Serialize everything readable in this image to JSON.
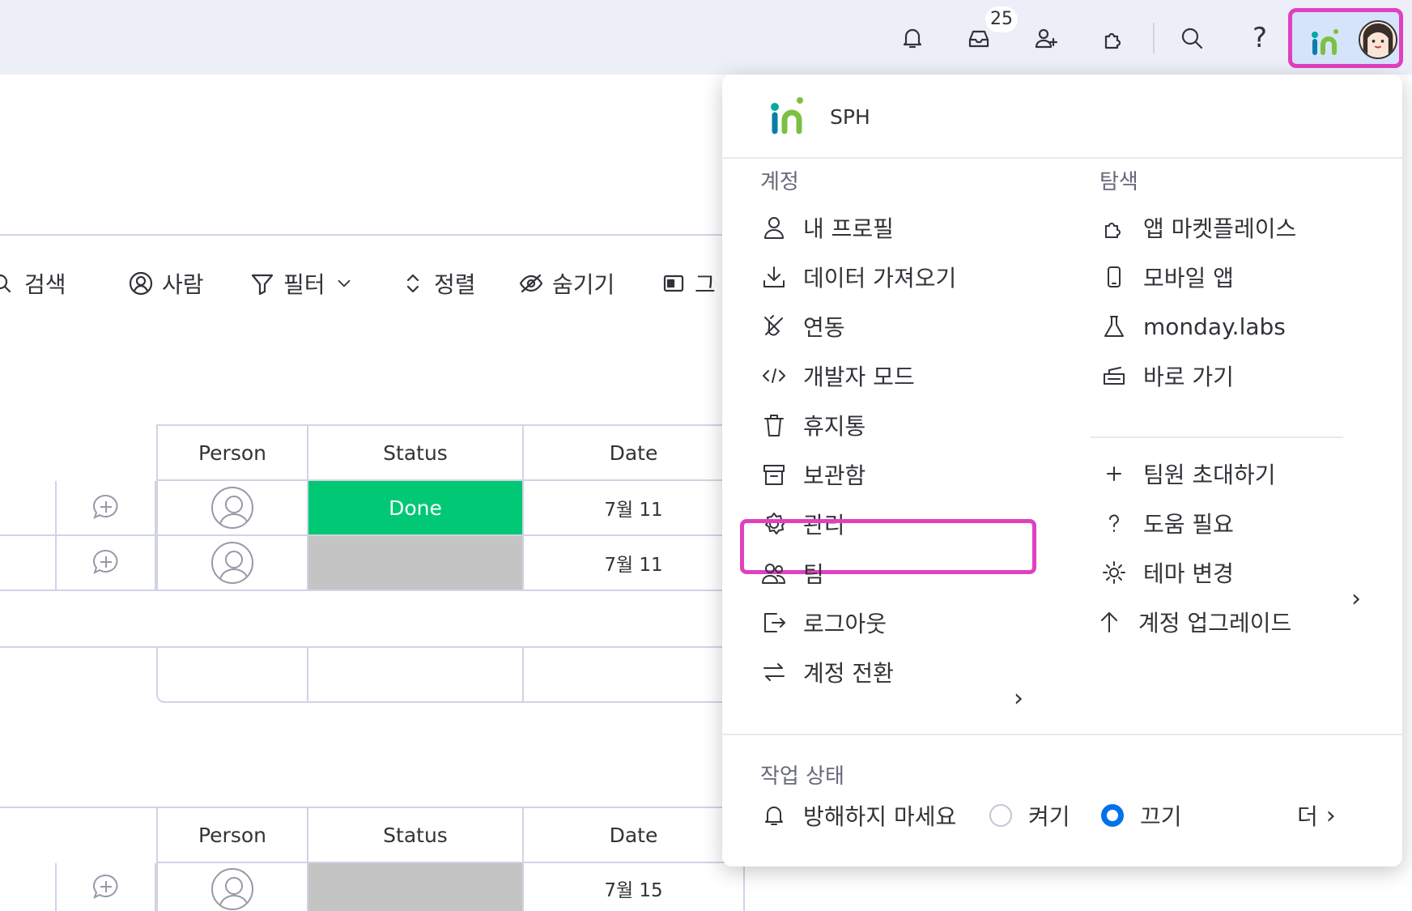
{
  "topbar": {
    "icons": [
      "bell-icon",
      "inbox-icon",
      "invite-icon",
      "apps-icon",
      "search-icon",
      "help-icon"
    ],
    "inbox_count": "25",
    "help_label": "?"
  },
  "toolbar": {
    "search": "검색",
    "person": "사람",
    "filter": "필터",
    "sort": "정렬",
    "hide": "숨기기",
    "group": "그"
  },
  "table1": {
    "headers": {
      "person": "Person",
      "status": "Status",
      "date": "Date"
    },
    "rows": [
      {
        "status": "Done",
        "date": "7월 11"
      },
      {
        "status": "",
        "date": "7월 11"
      }
    ]
  },
  "table2": {
    "headers": {
      "person": "Person",
      "status": "Status",
      "date": "Date"
    },
    "rows": [
      {
        "status": "",
        "date": "7월 15"
      }
    ]
  },
  "menu": {
    "account_name": "SPH",
    "account_section": "계정",
    "explore_section": "탐색",
    "account_items": [
      "내 프로필",
      "데이터 가져오기",
      "연동",
      "개발자 모드",
      "휴지통",
      "보관함",
      "관리",
      "팀",
      "로그아웃",
      "계정 전환"
    ],
    "explore_items": [
      "앱 마켓플레이스",
      "모바일 앱",
      "monday.labs",
      "바로 가기"
    ],
    "explore_items2": [
      "팀원 초대하기",
      "도움 필요",
      "테마 변경",
      "계정 업그레이드"
    ],
    "work_status_title": "작업 상태",
    "dnd_label": "방해하지 마세요",
    "on_label": "켜기",
    "off_label": "끄기",
    "more_label": "더",
    "selected_status": "끄기"
  },
  "colors": {
    "accent": "#0073ea",
    "done": "#00c875",
    "highlight": "#e040c0",
    "topbar": "#eceff8"
  }
}
